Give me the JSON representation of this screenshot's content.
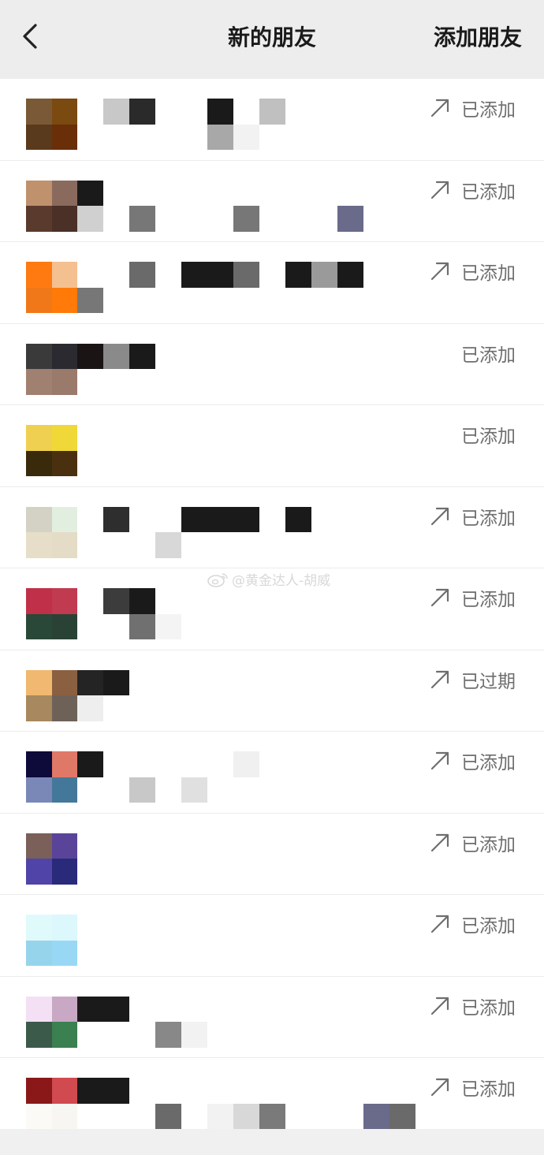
{
  "nav": {
    "back_icon": "chevron-left-icon",
    "title": "新的朋友",
    "action_label": "添加朋友"
  },
  "watermark": "@黄金达人-胡威",
  "rows": [
    {
      "status": "已添加",
      "show_arrow": true,
      "avatar": [
        "#7a5a36",
        "#7a4a10",
        "#5a3a1c",
        "#6a2e08"
      ],
      "strip": [
        "",
        "#c8c8c8",
        "#2a2a2a",
        "",
        "",
        "#1a1a1a",
        "",
        "#c0c0c0",
        "",
        "",
        "",
        "",
        "",
        "",
        "",
        "",
        "",
        "",
        "#a8a8a8",
        "#f2f2f2",
        "",
        "",
        "",
        "",
        "",
        ""
      ]
    },
    {
      "status": "已添加",
      "show_arrow": true,
      "avatar": [
        "#c0916d",
        "#8a6a5c",
        "#5a3a2c",
        "#4a3026"
      ],
      "strip": [
        "#1a1a1a",
        "",
        "",
        "",
        "",
        "",
        "",
        "",
        "",
        "",
        "",
        "",
        "",
        "#d0d0d0",
        "",
        "#777777",
        "",
        "",
        "",
        "#777777",
        "",
        "",
        "",
        "#6a6a8a",
        "",
        ""
      ]
    },
    {
      "status": "已添加",
      "show_arrow": true,
      "avatar": [
        "#ff7a10",
        "#f5c090",
        "#f07818",
        "#ff7a08"
      ],
      "strip": [
        "",
        "",
        "#6a6a6a",
        "",
        "#1a1a1a",
        "#1a1a1a",
        "#6a6a6a",
        "",
        "#1a1a1a",
        "#9a9a9a",
        "#1a1a1a",
        "",
        "",
        "#777777",
        "",
        "",
        "",
        "",
        "",
        "",
        "",
        "",
        "",
        "",
        "",
        ""
      ]
    },
    {
      "status": "已添加",
      "show_arrow": false,
      "avatar": [
        "#3a3a3a",
        "#2a2a30",
        "#a08070",
        "#9a7a6a"
      ],
      "strip": [
        "#1a1414",
        "#8a8a8a",
        "#1a1a1a",
        "",
        "",
        "",
        "",
        "",
        "",
        "",
        "",
        "",
        "",
        "",
        "",
        "",
        "",
        "",
        "",
        "",
        "",
        "",
        "",
        "",
        "",
        ""
      ]
    },
    {
      "status": "已添加",
      "show_arrow": false,
      "avatar": [
        "#f0d050",
        "#f0d838",
        "#3a2a0c",
        "#4a300e"
      ],
      "strip": [
        "",
        "",
        "",
        "",
        "",
        "",
        "",
        "",
        "",
        "",
        "",
        "",
        "",
        "",
        "",
        "",
        "",
        "",
        "",
        "",
        "",
        "",
        "",
        "",
        "",
        ""
      ]
    },
    {
      "status": "已添加",
      "show_arrow": true,
      "avatar": [
        "#d4d2c4",
        "#e2eee0",
        "#e6dec8",
        "#e4dcc6"
      ],
      "strip": [
        "",
        "#2e2e2e",
        "",
        "",
        "#1a1a1a",
        "#1a1a1a",
        "#1a1a1a",
        "",
        "#1a1a1a",
        "",
        "",
        "",
        "",
        "",
        "",
        "",
        "#d8d8d8",
        "",
        "",
        "",
        "",
        "",
        "",
        "",
        "",
        ""
      ]
    },
    {
      "status": "已添加",
      "show_arrow": true,
      "avatar": [
        "#c03048",
        "#c03a50",
        "#2a4838",
        "#2a4236"
      ],
      "strip": [
        "",
        "#3c3c3c",
        "#1a1a1a",
        "",
        "",
        "",
        "",
        "",
        "",
        "",
        "",
        "",
        "",
        "",
        "",
        "#707070",
        "#f4f4f4",
        "",
        "",
        "",
        "",
        "",
        "",
        "",
        "",
        ""
      ]
    },
    {
      "status": "已过期",
      "show_arrow": true,
      "avatar": [
        "#f0b870",
        "#8a6040",
        "#a8885e",
        "#6e6258"
      ],
      "strip": [
        "#242424",
        "#1a1a1a",
        "",
        "",
        "",
        "",
        "",
        "",
        "",
        "",
        "",
        "",
        "",
        "#eeeeee",
        "",
        "",
        "",
        "",
        "",
        "",
        "",
        "",
        "",
        "",
        "",
        ""
      ]
    },
    {
      "status": "已添加",
      "show_arrow": true,
      "avatar": [
        "#0e0a3a",
        "#e07868",
        "#7a88b8",
        "#44789a"
      ],
      "strip": [
        "#1a1a1a",
        "",
        "",
        "",
        "",
        "",
        "#f0f0f0",
        "",
        "",
        "",
        "",
        "",
        "",
        "",
        "",
        "#c8c8c8",
        "",
        "#e0e0e0",
        "",
        "",
        "",
        "",
        "",
        "",
        "",
        ""
      ]
    },
    {
      "status": "已添加",
      "show_arrow": true,
      "avatar": [
        "#7a6058",
        "#5a449a",
        "#5044a8",
        "#2a2a7a"
      ],
      "strip": [
        "",
        "",
        "",
        "",
        "",
        "",
        "",
        "",
        "",
        "",
        "",
        "",
        "",
        "",
        "",
        "",
        "",
        "",
        "",
        "",
        "",
        "",
        "",
        "",
        "",
        ""
      ]
    },
    {
      "status": "已添加",
      "show_arrow": true,
      "avatar": [
        "#e0fafc",
        "#dcf8fc",
        "#96d4ec",
        "#98d8f4"
      ],
      "strip": [
        "",
        "",
        "",
        "",
        "",
        "",
        "",
        "",
        "",
        "",
        "",
        "",
        "",
        "",
        "",
        "",
        "",
        "",
        "",
        "",
        "",
        "",
        "",
        "",
        "",
        ""
      ]
    },
    {
      "status": "已添加",
      "show_arrow": true,
      "avatar": [
        "#f4e0f4",
        "#c8a8c4",
        "#3c5a4a",
        "#3a8050"
      ],
      "strip": [
        "#1a1a1a",
        "#1a1a1a",
        "",
        "",
        "",
        "",
        "",
        "",
        "",
        "",
        "",
        "",
        "",
        "",
        "",
        "",
        "#888888",
        "#f2f2f2",
        "",
        "",
        "",
        "",
        "",
        "",
        "",
        ""
      ]
    },
    {
      "status": "已添加",
      "show_arrow": true,
      "avatar": [
        "#8a1818",
        "#d04a50",
        "#fcfaf6",
        "#f8f6f2"
      ],
      "strip": [
        "#1a1a1a",
        "#1a1a1a",
        "",
        "",
        "",
        "",
        "",
        "",
        "",
        "",
        "",
        "",
        "",
        "",
        "",
        "",
        "#6a6a6a",
        "",
        "#f2f2f2",
        "#d8d8d8",
        "#7a7a7a",
        "",
        "",
        "",
        "#6a6a8a",
        "#6a6a6a"
      ]
    }
  ]
}
